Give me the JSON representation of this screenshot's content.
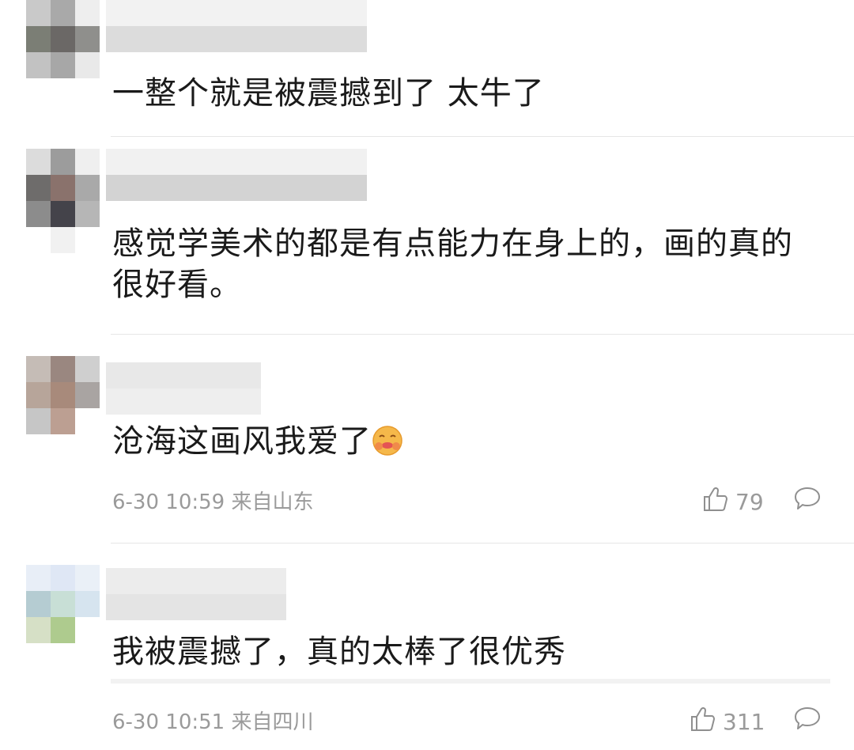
{
  "comments": [
    {
      "text": "一整个就是被震撼到了 太牛了"
    },
    {
      "text_line1": "感觉学美术的都是有点能力在身上的，画的真的",
      "text_line2": "很好看。"
    },
    {
      "text": "沧海这画风我爱了",
      "emoji": "face-hugging-icon",
      "time": "6-30 10:59 来自山东",
      "likes": "79"
    },
    {
      "text": "我被震撼了，真的太棒了很优秀",
      "time": "6-30 10:51 来自四川",
      "likes": "311"
    }
  ],
  "icons": {
    "like": "thumbs-up-icon",
    "reply": "speech-bubble-icon"
  },
  "colors": {
    "text": "#1a1a1a",
    "meta": "#9a9a9a",
    "divider": "#e6e6e6",
    "emoji": "#f5b84a"
  }
}
